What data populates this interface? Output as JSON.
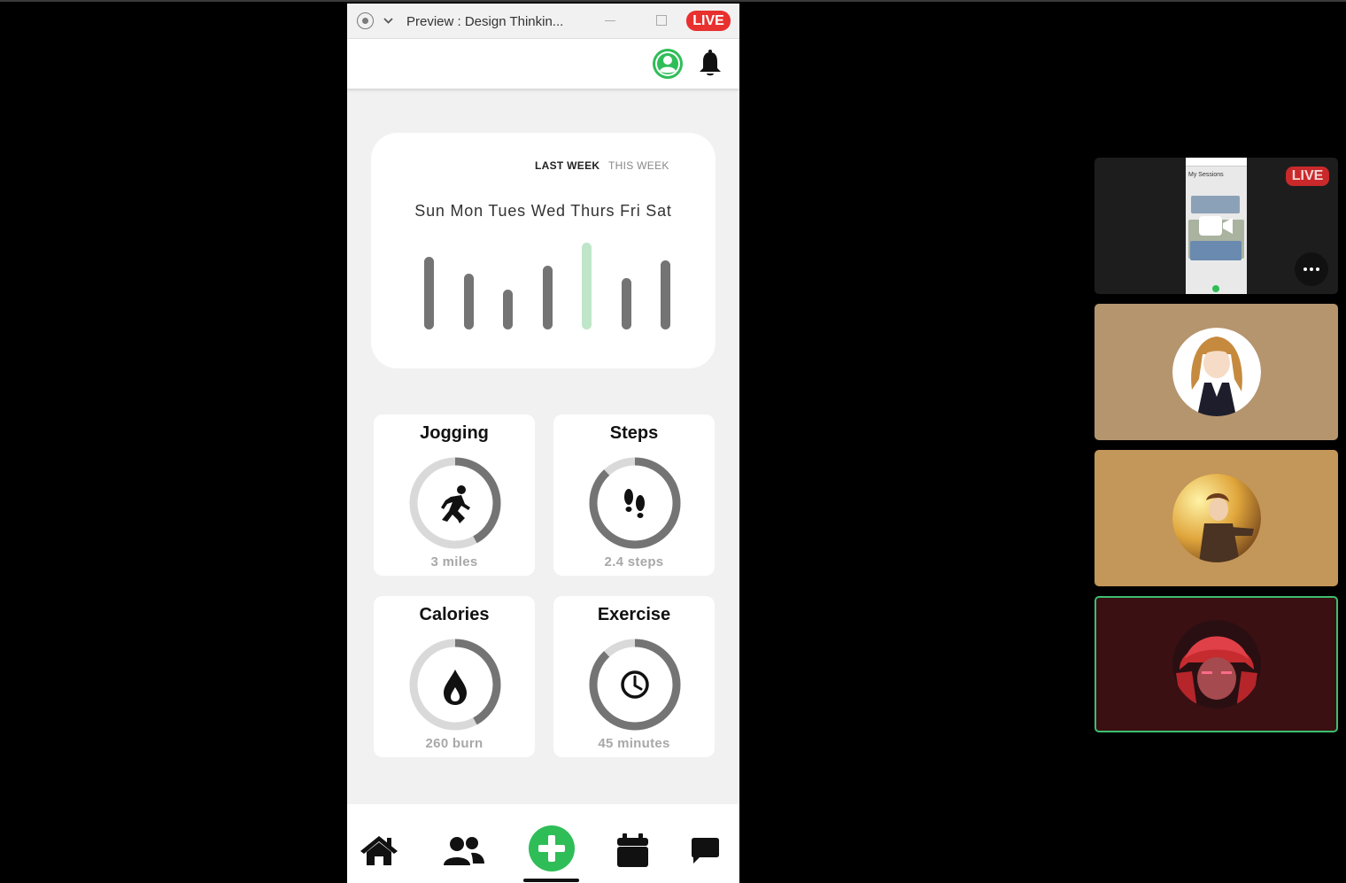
{
  "window": {
    "title": "Preview : Design Thinkin...",
    "live_label": "LIVE"
  },
  "week_card": {
    "tabs": [
      {
        "label": "LAST WEEK",
        "active": true
      },
      {
        "label": "THIS WEEK",
        "active": false
      }
    ],
    "days": "Sun Mon Tues Wed Thurs Fri Sat",
    "activity_levels": [
      {
        "day": "Sun",
        "level": 0.82,
        "highlight": false
      },
      {
        "day": "Mon",
        "level": 0.63,
        "highlight": false
      },
      {
        "day": "Tues",
        "level": 0.45,
        "highlight": false
      },
      {
        "day": "Wed",
        "level": 0.72,
        "highlight": false
      },
      {
        "day": "Thurs",
        "level": 0.98,
        "highlight": true
      },
      {
        "day": "Fri",
        "level": 0.58,
        "highlight": false
      },
      {
        "day": "Sat",
        "level": 0.78,
        "highlight": false
      }
    ]
  },
  "stats": [
    {
      "title": "Jogging",
      "value": "3 miles",
      "icon": "runner-icon",
      "progress": 0.42
    },
    {
      "title": "Steps",
      "value": "2.4 steps",
      "icon": "footprints-icon",
      "progress": 0.88
    },
    {
      "title": "Calories",
      "value": "260 burn",
      "icon": "flame-icon",
      "progress": 0.42
    },
    {
      "title": "Exercise",
      "value": "45 minutes",
      "icon": "clock-icon",
      "progress": 0.88
    }
  ],
  "nav": [
    {
      "name": "home-icon"
    },
    {
      "name": "users-icon"
    },
    {
      "name": "add-icon",
      "active": true
    },
    {
      "name": "calendar-icon"
    },
    {
      "name": "chat-icon"
    }
  ],
  "participants": {
    "screen_share": {
      "live_label": "LIVE",
      "thumb_title": "My Sessions"
    }
  },
  "colors": {
    "accent_green": "#2fbd58",
    "live_red": "#e8302f",
    "bar_gray": "#747474",
    "bar_highlight": "#bfe6c8"
  }
}
